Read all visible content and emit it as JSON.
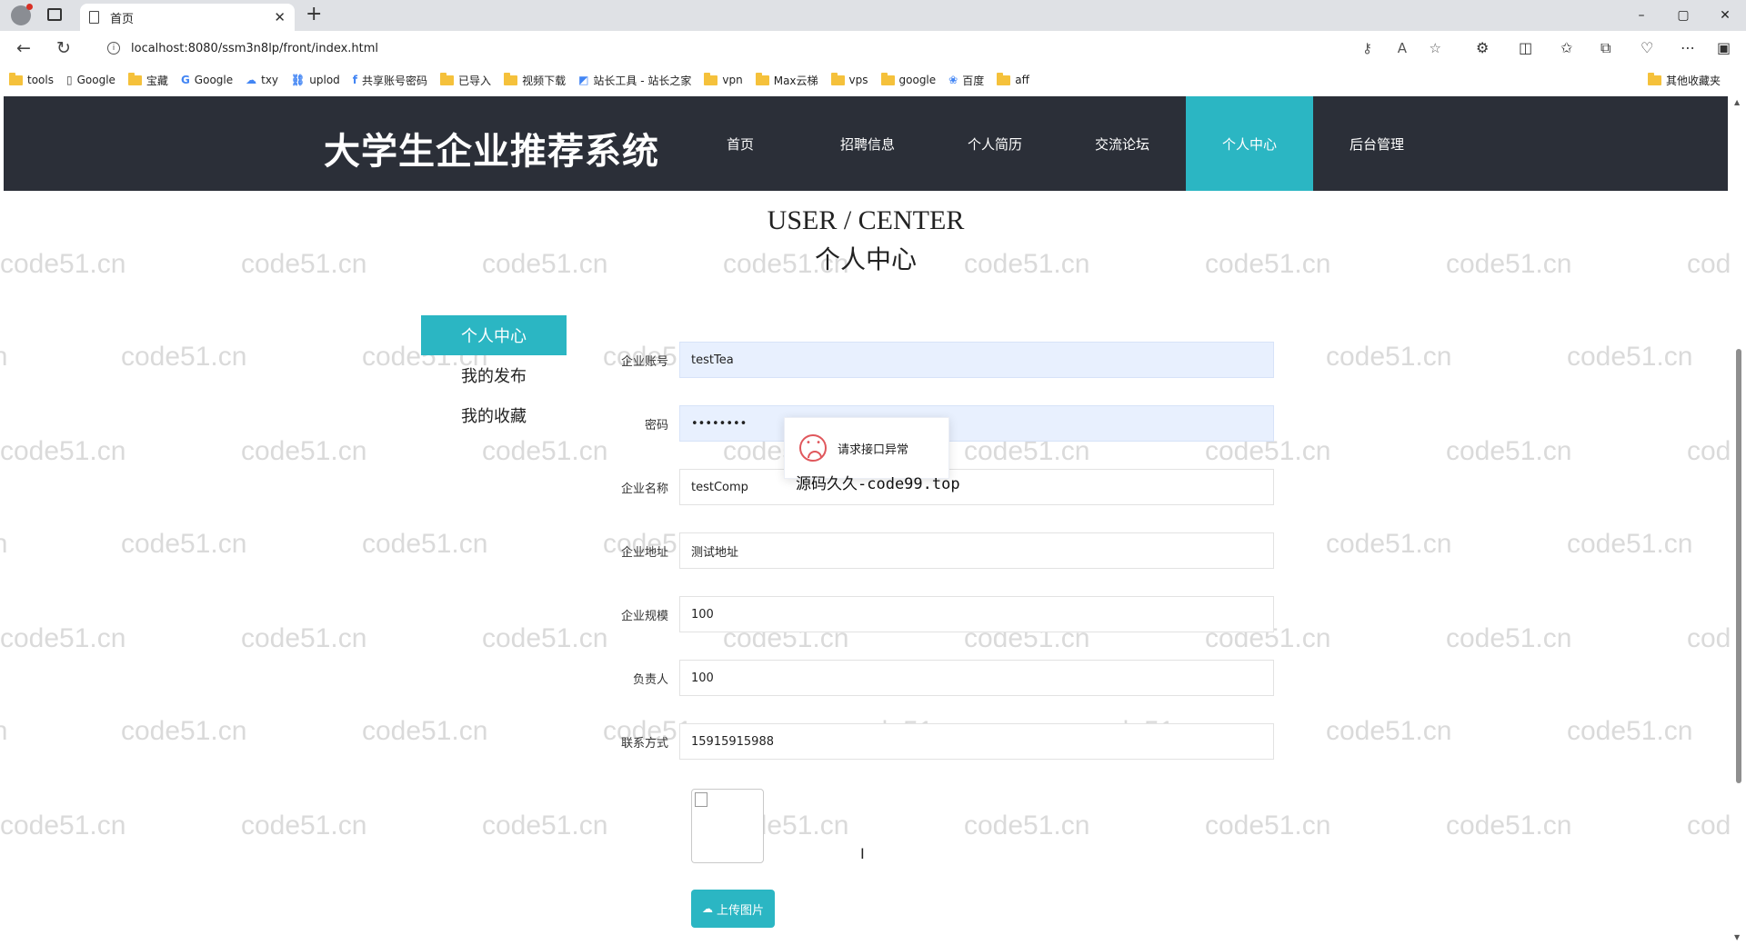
{
  "browser": {
    "tab_title": "首页",
    "tab_close": "✕",
    "new_tab": "+",
    "url": "localhost:8080/ssm3n8lp/front/index.html",
    "window_controls": [
      "–",
      "▢",
      "✕"
    ],
    "bookmarks": [
      {
        "label": "tools",
        "icon": "folder-icon"
      },
      {
        "label": "Google",
        "icon": "page-icon"
      },
      {
        "label": "宝藏",
        "icon": "folder-icon"
      },
      {
        "label": "Google",
        "icon": "google-icon"
      },
      {
        "label": "txy",
        "icon": "cloud-icon"
      },
      {
        "label": "uplod",
        "icon": "link-icon"
      },
      {
        "label": "共享账号密码",
        "icon": "brand-icon"
      },
      {
        "label": "已导入",
        "icon": "folder-icon"
      },
      {
        "label": "视频下载",
        "icon": "folder-icon"
      },
      {
        "label": "站长工具 - 站长之家",
        "icon": "brand-icon"
      },
      {
        "label": "vpn",
        "icon": "folder-icon"
      },
      {
        "label": "Max云梯",
        "icon": "folder-icon"
      },
      {
        "label": "vps",
        "icon": "folder-icon"
      },
      {
        "label": "google",
        "icon": "folder-icon"
      },
      {
        "label": "百度",
        "icon": "baidu-icon"
      },
      {
        "label": "aff",
        "icon": "folder-icon"
      }
    ],
    "other_bookmarks": "其他收藏夹"
  },
  "site": {
    "logo": "大学生企业推荐系统",
    "nav": [
      "首页",
      "招聘信息",
      "个人简历",
      "交流论坛",
      "个人中心",
      "后台管理"
    ],
    "active_nav_index": 4,
    "accent_color": "#2bb6c3",
    "header_color": "#2b2f38"
  },
  "section": {
    "title_en": "USER / CENTER",
    "title_cn": "个人中心"
  },
  "sidebar": {
    "items": [
      "个人中心",
      "我的发布",
      "我的收藏"
    ],
    "active_index": 0
  },
  "form": {
    "fields": [
      {
        "label": "企业账号",
        "value": "testTea"
      },
      {
        "label": "密码",
        "value": "••••••••"
      },
      {
        "label": "企业名称",
        "value": "testComp"
      },
      {
        "label": "企业地址",
        "value": "测试地址"
      },
      {
        "label": "企业规模",
        "value": "100"
      },
      {
        "label": "负责人",
        "value": "100"
      },
      {
        "label": "联系方式",
        "value": "15915915988"
      }
    ],
    "upload_label": "上传图片"
  },
  "toast": {
    "message": "请求接口异常"
  },
  "overlay_text": "源码久久-code99.top",
  "watermark_text": "code51.cn"
}
